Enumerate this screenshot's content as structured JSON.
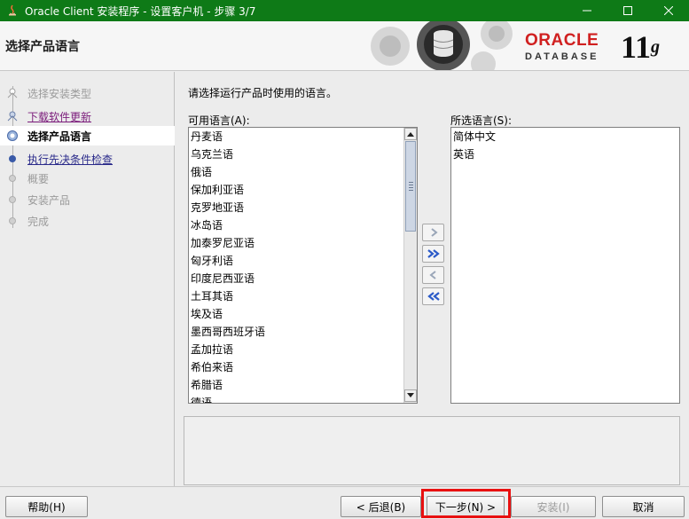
{
  "window": {
    "title": "Oracle Client 安装程序 - 设置客户机 - 步骤 3/7"
  },
  "header": {
    "page_title": "选择产品语言",
    "brand_oracle": "ORACLE",
    "brand_database": "DATABASE",
    "brand_version": "11",
    "brand_version_suffix": "g"
  },
  "steps": [
    {
      "label": "选择安装类型",
      "state": "disabled"
    },
    {
      "label": "下载软件更新",
      "state": "visited-link"
    },
    {
      "label": "选择产品语言",
      "state": "current"
    },
    {
      "label": "执行先决条件检查",
      "state": "link"
    },
    {
      "label": "概要",
      "state": "disabled"
    },
    {
      "label": "安装产品",
      "state": "disabled"
    },
    {
      "label": "完成",
      "state": "disabled"
    }
  ],
  "main": {
    "prompt": "请选择运行产品时使用的语言。",
    "available_label": "可用语言(A):",
    "selected_label": "所选语言(S):",
    "available_languages": [
      "丹麦语",
      "乌克兰语",
      "俄语",
      "保加利亚语",
      "克罗地亚语",
      "冰岛语",
      "加泰罗尼亚语",
      "匈牙利语",
      "印度尼西亚语",
      "土耳其语",
      "埃及语",
      "墨西哥西班牙语",
      "孟加拉语",
      "希伯来语",
      "希腊语",
      "德语"
    ],
    "selected_languages": [
      "简体中文",
      "英语"
    ]
  },
  "buttons": {
    "help": "帮助(H)",
    "back": "< 后退(B)",
    "next": "下一步(N) >",
    "install": "安装(I)",
    "cancel": "取消"
  },
  "colors": {
    "titlebar": "#0e7a17",
    "oracle_red": "#d02020",
    "highlight": "#e81010"
  }
}
